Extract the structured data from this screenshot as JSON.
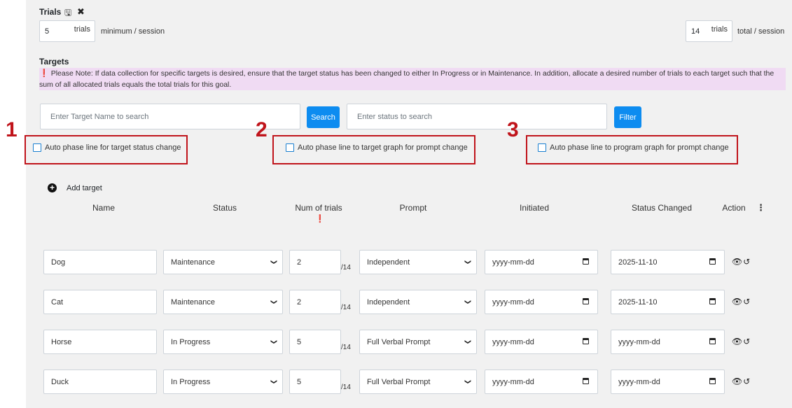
{
  "trials": {
    "title": "Trials",
    "min_value": "5",
    "min_unit": "trials",
    "min_label": "minimum / session",
    "total_value": "14",
    "total_unit": "trials",
    "total_label": "total / session"
  },
  "targets": {
    "title": "Targets",
    "note": "Please Note: If data collection for specific targets is desired, ensure that the target status has been changed to either In Progress or in Maintenance. In addition, allocate a desired number of trials to each target such that the sum of all allocated trials equals the total trials for this goal."
  },
  "search": {
    "name_placeholder": "Enter Target Name to search",
    "search_label": "Search",
    "status_placeholder": "Enter status to search",
    "filter_label": "Filter"
  },
  "options": [
    {
      "callout": "1",
      "label": "Auto phase line for target status change"
    },
    {
      "callout": "2",
      "label": "Auto phase line to target graph for prompt change"
    },
    {
      "callout": "3",
      "label": "Auto phase line to program graph for prompt change"
    }
  ],
  "table": {
    "add_target": "Add target",
    "headers": {
      "name": "Name",
      "status": "Status",
      "num_trials": "Num of trials",
      "prompt": "Prompt",
      "initiated": "Initiated",
      "status_changed": "Status Changed",
      "action": "Action"
    },
    "rows": [
      {
        "name": "Dog",
        "status": "Maintenance",
        "trials": "2",
        "of": "/14",
        "prompt": "Independent",
        "initiated": "yyyy-mm-dd",
        "changed": "2025-11-10"
      },
      {
        "name": "Cat",
        "status": "Maintenance",
        "trials": "2",
        "of": "/14",
        "prompt": "Independent",
        "initiated": "yyyy-mm-dd",
        "changed": "2025-11-10"
      },
      {
        "name": "Horse",
        "status": "In Progress",
        "trials": "5",
        "of": "/14",
        "prompt": "Full Verbal Prompt",
        "initiated": "yyyy-mm-dd",
        "changed": "yyyy-mm-dd"
      },
      {
        "name": "Duck",
        "status": "In Progress",
        "trials": "5",
        "of": "/14",
        "prompt": "Full Verbal Prompt",
        "initiated": "yyyy-mm-dd",
        "changed": "yyyy-mm-dd"
      }
    ]
  },
  "colors": {
    "accent": "#0d8cf0",
    "callout_red": "#c0141b",
    "note_bg": "#f0dbf3"
  },
  "icons": [
    "save-icon",
    "close-icon",
    "info-icon",
    "plus-circle-icon",
    "kebab-icon",
    "chevron-down-icon",
    "calendar-icon",
    "eye-icon",
    "history-icon"
  ]
}
